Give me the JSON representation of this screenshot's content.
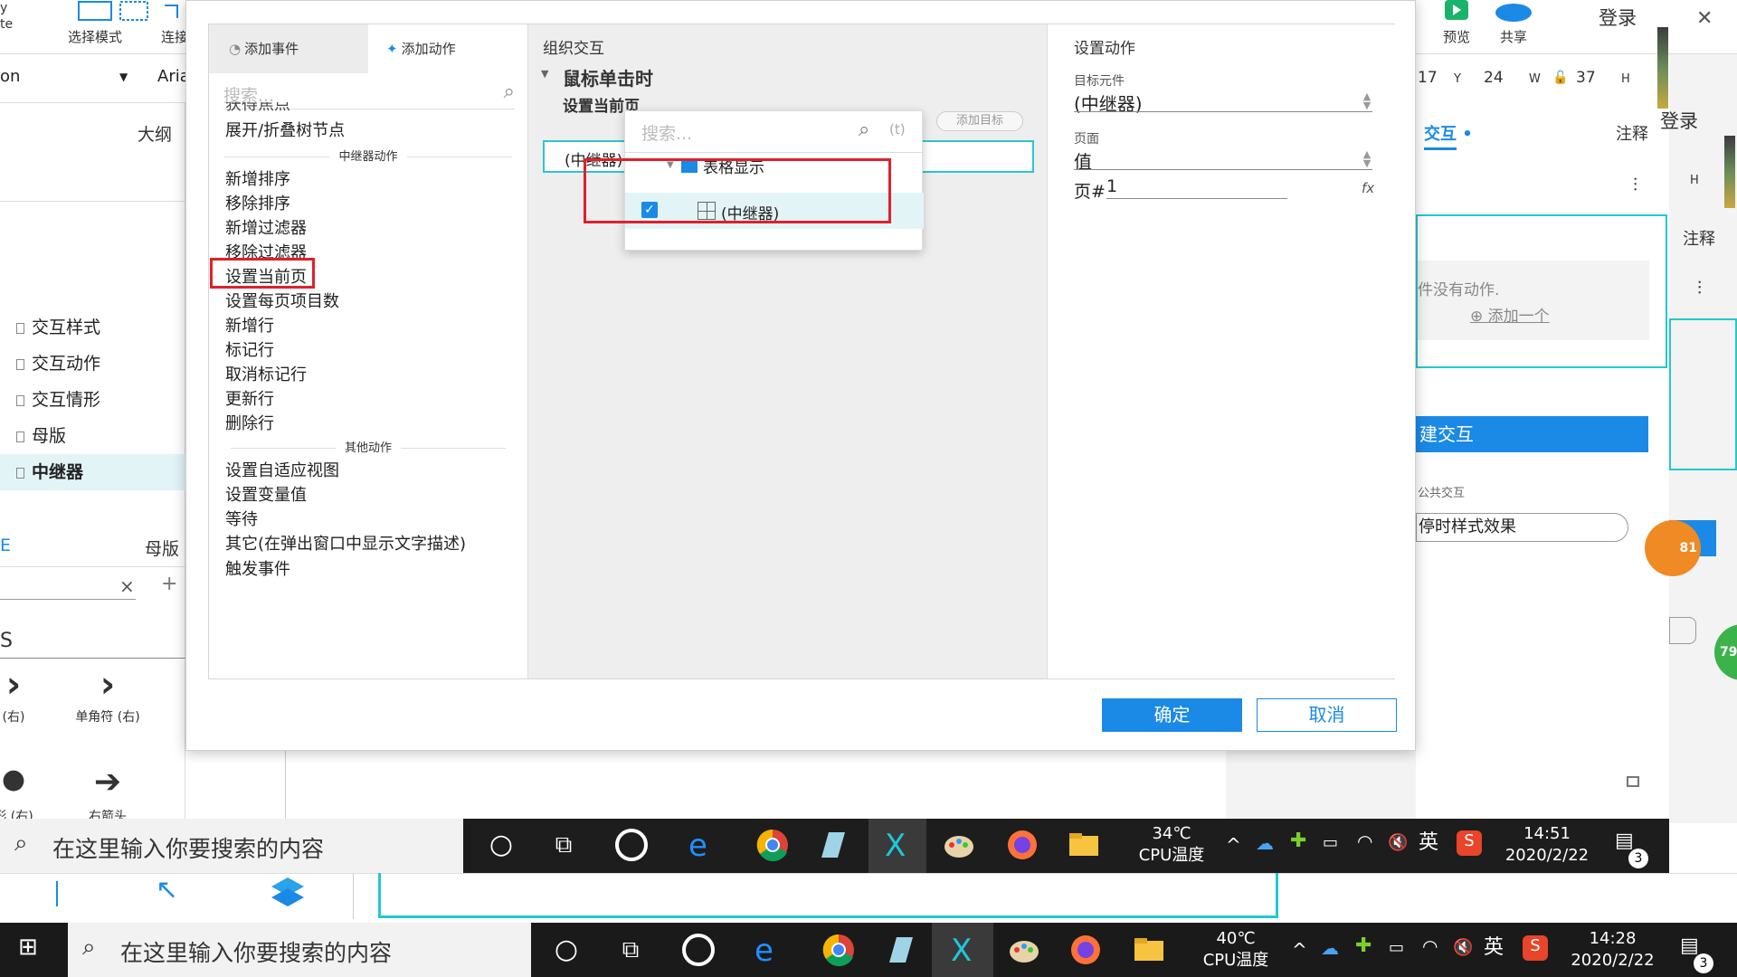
{
  "background": {
    "toolbar": {
      "select_mode": "选择模式",
      "connect": "连接",
      "preview": "预览",
      "share": "共享",
      "login": "登录",
      "left_cut": "y\nte"
    },
    "font_field": "on",
    "font_name": "Aria",
    "coords": {
      "x": "17",
      "x_label": "Y",
      "y": "24",
      "w_label": "W",
      "w": "37",
      "h_label": "H"
    },
    "left_panel": {
      "outline_tab": "大纲",
      "items": [
        "交互样式",
        "交互动作",
        "交互情形",
        "母版",
        "中继器"
      ],
      "tab_master": "母版",
      "tab_left": "E",
      "search_clear": "×",
      "add": "+",
      "lib_title": "S",
      "lib_row1": [
        "(右)",
        "单角符 (右)"
      ],
      "lib_row2": [
        "形 (右)",
        "右箭头"
      ]
    },
    "right_panel": {
      "login2": "登录",
      "tab_interaction": "交互",
      "tab_notes": "注释",
      "tab_notes2": "注释",
      "h_label": "H",
      "no_action": "件没有动作.",
      "add_one": "添加一个",
      "new_interaction": "建交互",
      "public_interaction": "公共交互",
      "hover_style": "停时样式效果"
    },
    "badges": {
      "orange": "81",
      "green": "79"
    }
  },
  "dialog": {
    "tabs": {
      "add_event": "添加事件",
      "add_action": "添加动作"
    },
    "search_placeholder": "搜索...",
    "cut_item": "获得焦点",
    "expand_item": "展开/折叠树节点",
    "repeater_section": "中继器动作",
    "repeater_actions": [
      "新增排序",
      "移除排序",
      "新增过滤器",
      "移除过滤器",
      "设置当前页",
      "设置每页项目数",
      "新增行",
      "标记行",
      "取消标记行",
      "更新行",
      "删除行"
    ],
    "other_section": "其他动作",
    "other_actions": [
      "设置自适应视图",
      "设置变量值",
      "等待",
      "其它(在弹出窗口中显示文字描述)",
      "触发事件"
    ],
    "organize_title": "组织交互",
    "event_title": "鼠标单击时",
    "action_title": "设置当前页",
    "add_target": "添加目标",
    "action_row": "(中继器) 到 1",
    "popup": {
      "search_placeholder": "搜索...",
      "filter": "(t)",
      "group": "表格显示",
      "item": "(中继器)"
    },
    "config": {
      "title": "设置动作",
      "target_label": "目标元件",
      "target_value": "(中继器)",
      "page_label": "页面",
      "page_value": "值",
      "page_num_label": "页#",
      "page_num_value": "1",
      "fx": "fx"
    },
    "ok": "确定",
    "cancel": "取消"
  },
  "inner_taskbar": {
    "search": "在这里输入你要搜索的内容",
    "temp": "34℃",
    "temp_label": "CPU温度",
    "ime": "英",
    "time": "14:51",
    "date": "2020/2/22",
    "notif": "3"
  },
  "outer_taskbar": {
    "search": "在这里输入你要搜索的内容",
    "temp": "40℃",
    "temp_label": "CPU温度",
    "ime": "英",
    "time": "14:28",
    "date": "2020/2/22",
    "notif": "3"
  },
  "colors": {
    "accent": "#1a8ae6",
    "highlight_box": "#e0202a",
    "teal": "#22c8cf",
    "selection": "#e3f4f7"
  }
}
